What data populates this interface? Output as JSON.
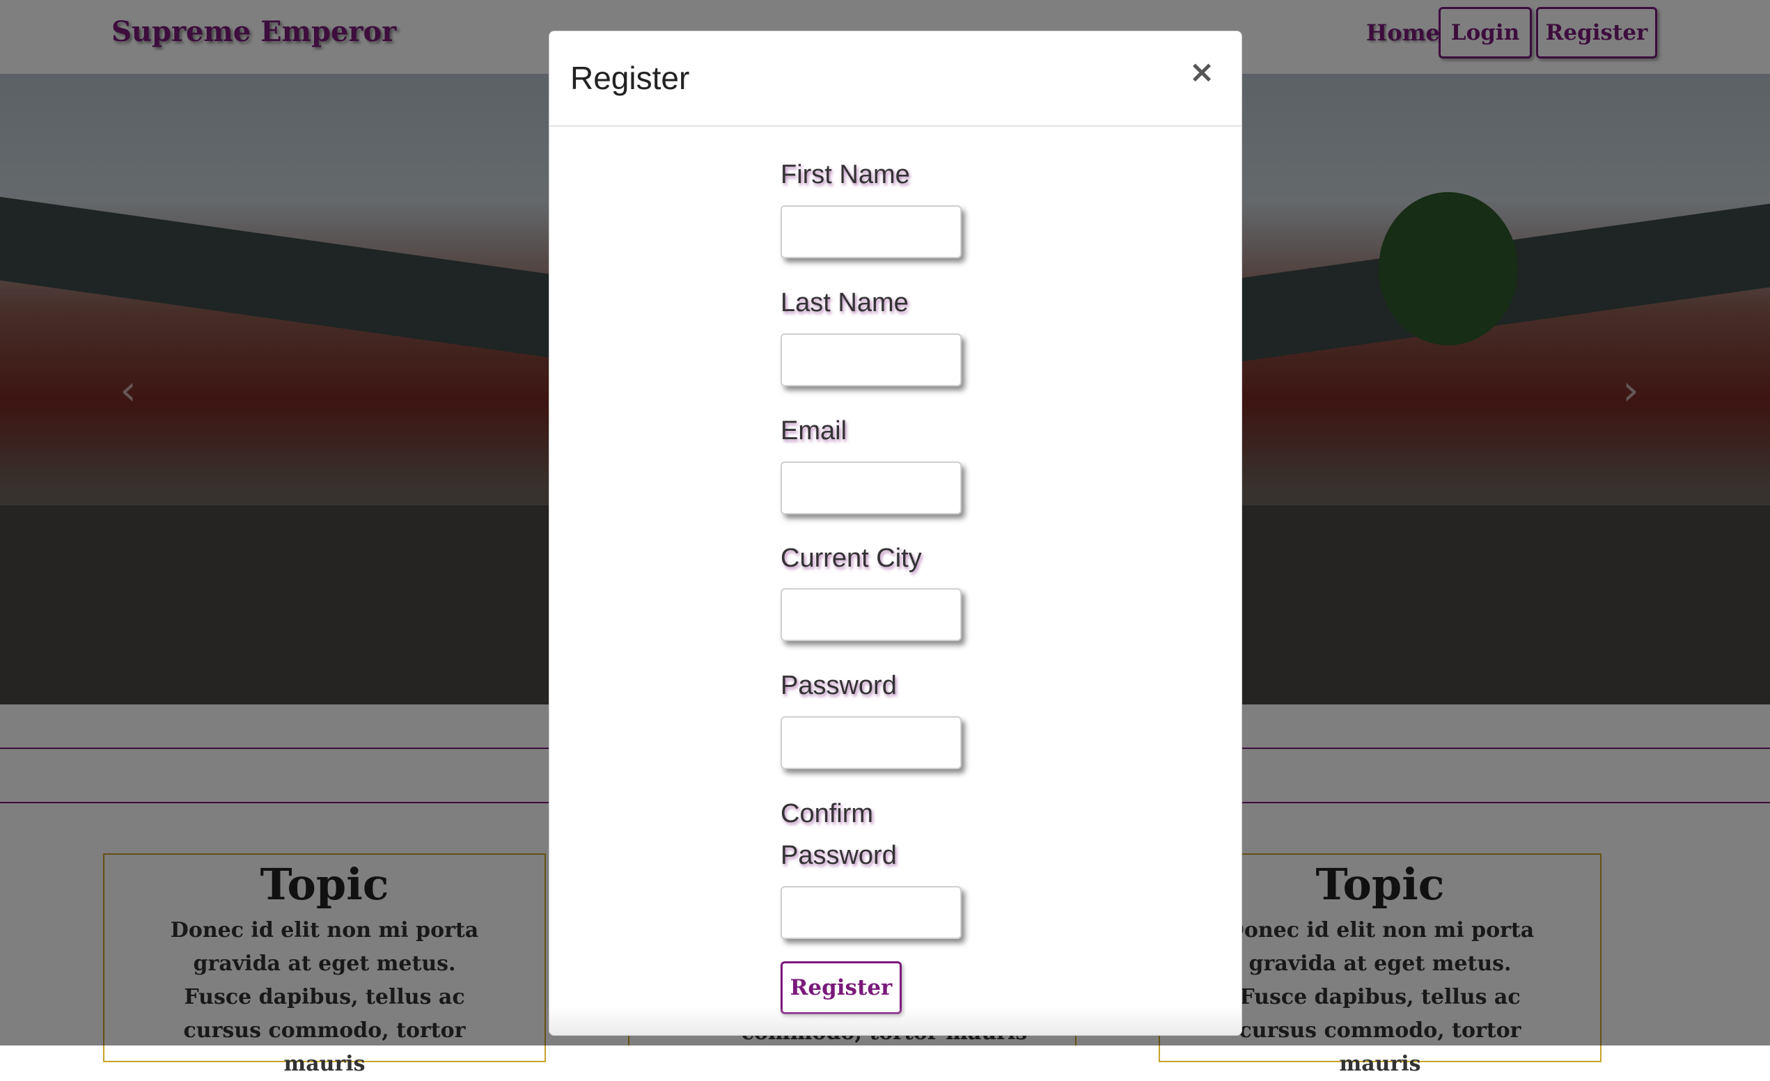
{
  "navbar": {
    "brand": "Supreme Emperor",
    "home_label": "Home",
    "login_label": "Login",
    "register_label": "Register"
  },
  "hero": {
    "prev_icon": "chevron-left-icon",
    "next_icon": "chevron-right-icon",
    "prev_glyph": "‹",
    "next_glyph": "›"
  },
  "topics": [
    {
      "title": "Topic",
      "text": "Donec id elit non mi porta gravida at eget metus. Fusce dapibus, tellus ac cursus commodo, tortor mauris"
    },
    {
      "title": "Topic",
      "text": "Donec id elit non mi porta gravida at eget metus. Fusce dapibus, tellus ac cursus commodo, tortor mauris"
    }
  ],
  "topic_mid_text": "commodo, tortor mauris",
  "modal": {
    "title": "Register",
    "close_glyph": "×",
    "fields": [
      {
        "label": "First Name",
        "value": ""
      },
      {
        "label": "Last Name",
        "value": ""
      },
      {
        "label": "Email",
        "value": ""
      },
      {
        "label": "Current City",
        "value": ""
      },
      {
        "label": "Password",
        "value": ""
      },
      {
        "label": "Confirm Password",
        "value": ""
      }
    ],
    "submit_label": "Register"
  },
  "colors": {
    "accent": "#7a1a7a",
    "card_border": "#c9a227"
  }
}
